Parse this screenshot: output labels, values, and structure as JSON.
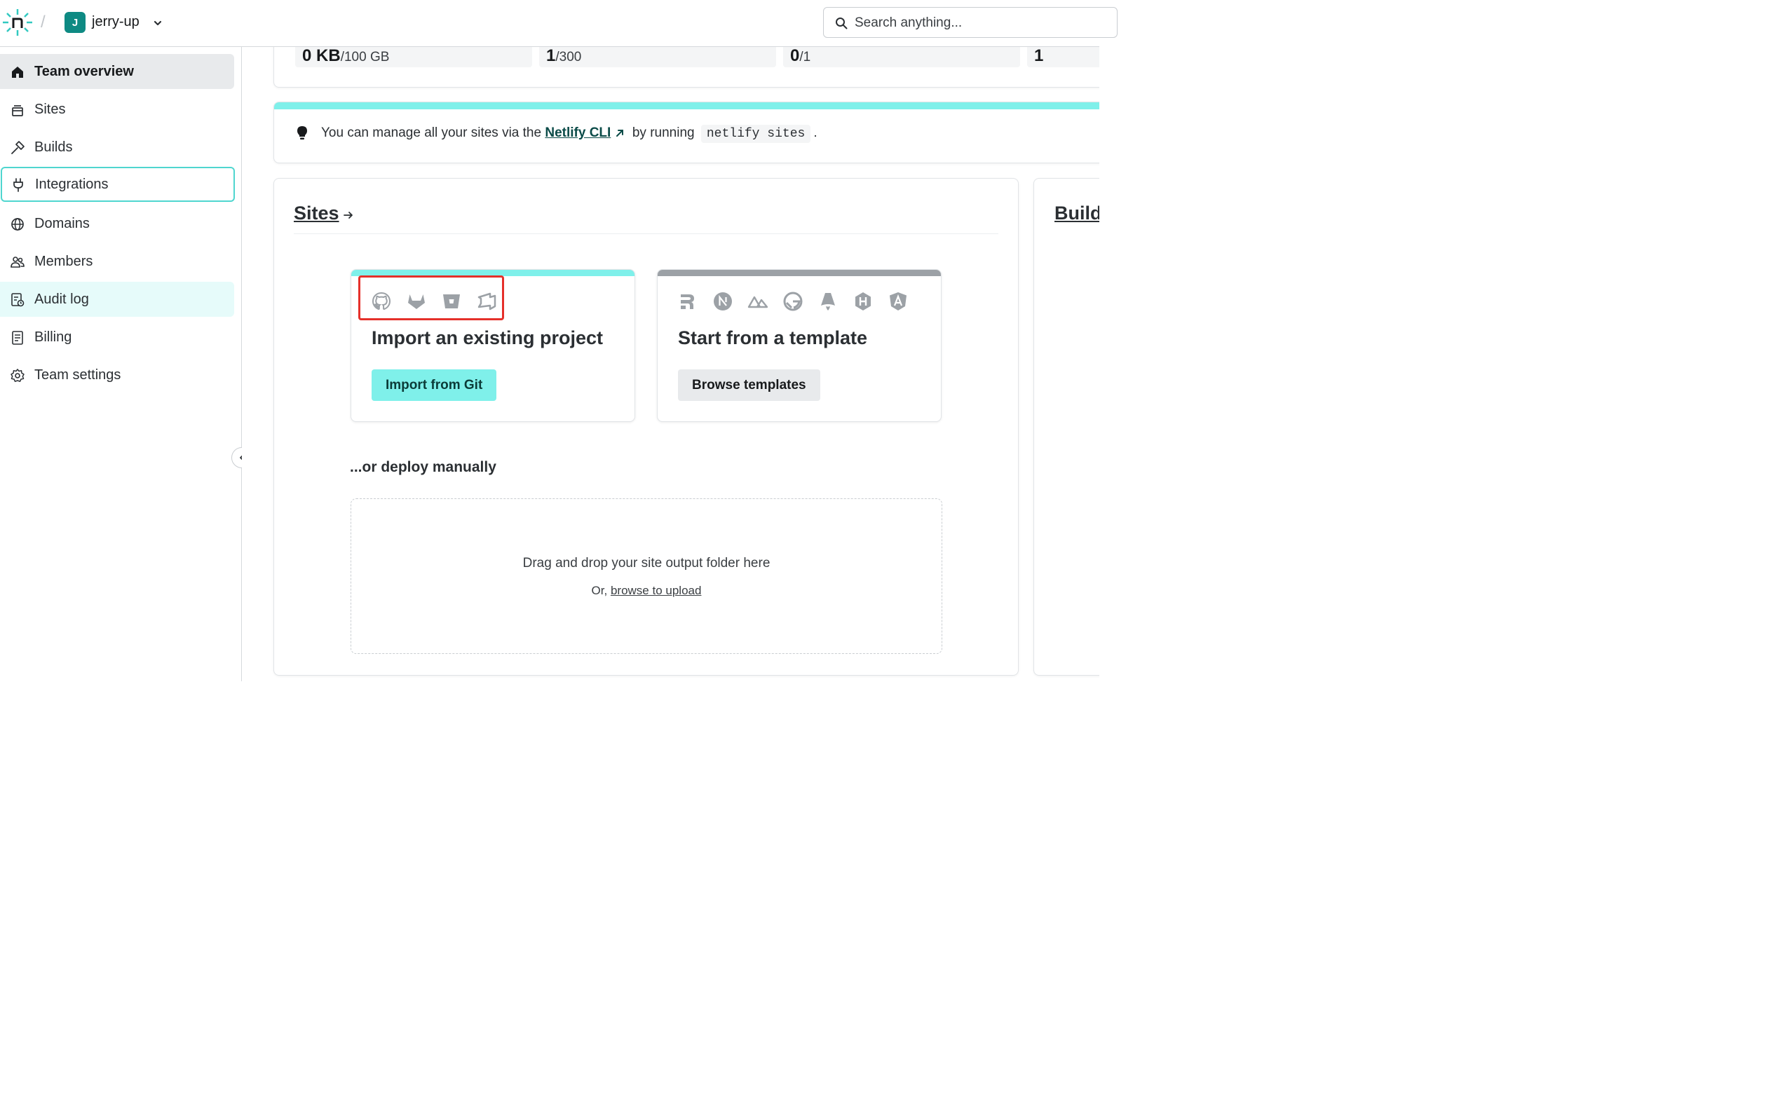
{
  "header": {
    "team_initial": "J",
    "team_name": "jerry-up",
    "search_placeholder": "Search anything..."
  },
  "sidebar": {
    "items": [
      {
        "label": "Team overview",
        "icon": "home-icon",
        "state": "active"
      },
      {
        "label": "Sites",
        "icon": "sites-icon",
        "state": ""
      },
      {
        "label": "Builds",
        "icon": "hammer-icon",
        "state": ""
      },
      {
        "label": "Integrations",
        "icon": "plug-icon",
        "state": "focused"
      },
      {
        "label": "Domains",
        "icon": "globe-icon",
        "state": ""
      },
      {
        "label": "Members",
        "icon": "members-icon",
        "state": ""
      },
      {
        "label": "Audit log",
        "icon": "audit-log-icon",
        "state": "hover"
      },
      {
        "label": "Billing",
        "icon": "billing-icon",
        "state": ""
      },
      {
        "label": "Team settings",
        "icon": "gear-icon",
        "state": ""
      }
    ]
  },
  "usage": {
    "tiles": [
      {
        "value": "0 KB",
        "limit": "/100 GB"
      },
      {
        "value": "1",
        "limit": "/300"
      },
      {
        "value": "0",
        "limit": "/1"
      },
      {
        "value": "1",
        "limit": ""
      }
    ]
  },
  "tip": {
    "prefix": "You can manage all your sites via the",
    "link": "Netlify CLI",
    "middle": "by running",
    "code": "netlify sites",
    "suffix": "."
  },
  "sites": {
    "title": "Sites",
    "import_card": {
      "title": "Import an existing project",
      "button": "Import from Git",
      "icons": [
        "github-icon",
        "gitlab-icon",
        "bitbucket-icon",
        "azure-devops-icon"
      ],
      "stripe_color": "#7ff0ea"
    },
    "template_card": {
      "title": "Start from a template",
      "button": "Browse templates",
      "icons": [
        "remix-icon",
        "nextjs-icon",
        "nuxt-icon",
        "gatsby-icon",
        "astro-icon",
        "hydrogen-icon",
        "angular-icon"
      ],
      "stripe_color": "#9ca1a6"
    },
    "deploy_heading": "...or deploy manually",
    "drop_text": "Drag and drop your site output folder here",
    "drop_sub_prefix": "Or,",
    "drop_sub_link": "browse to upload"
  },
  "builds": {
    "title": "Builds"
  },
  "colors": {
    "accent": "#7ff0ea",
    "brand_teal": "#0e8a83",
    "highlight": "#e5302a"
  }
}
